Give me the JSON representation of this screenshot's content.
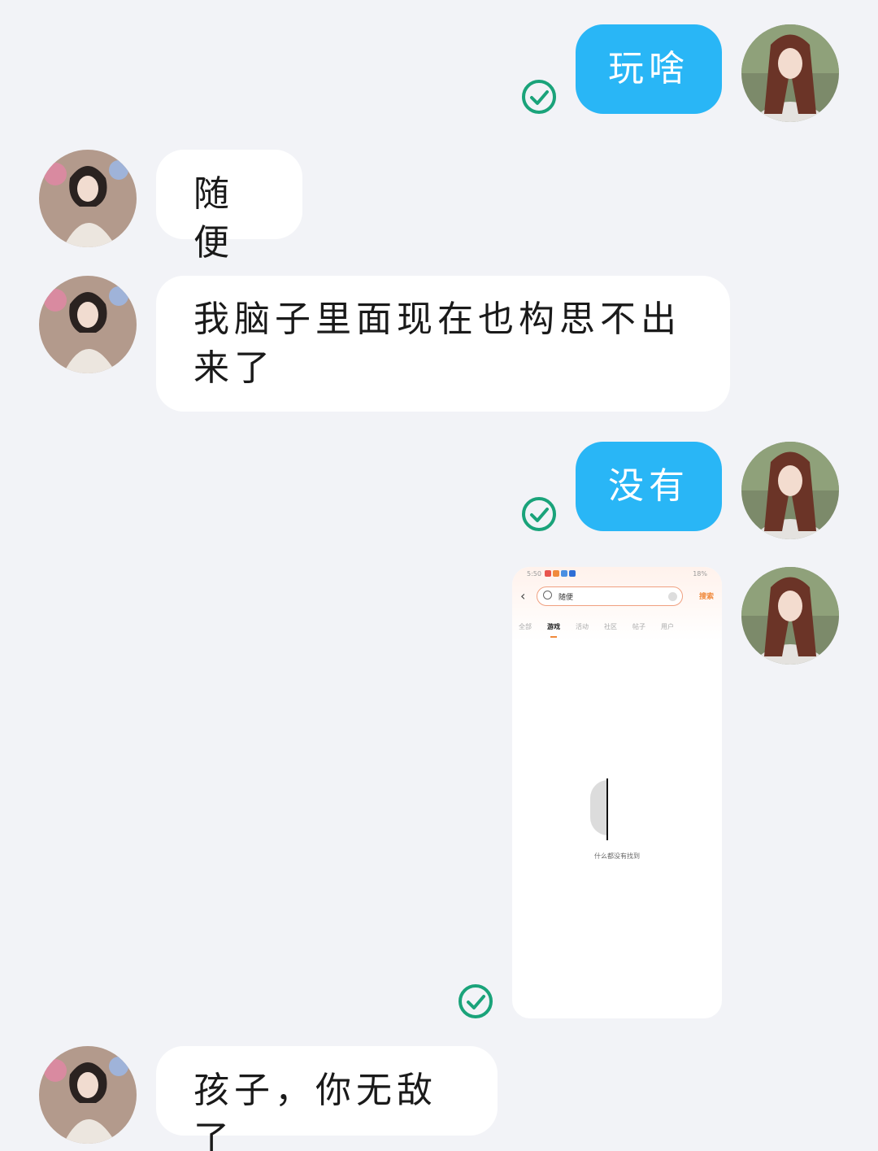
{
  "messages": [
    {
      "from": "me",
      "text": "玩啥",
      "status": "read"
    },
    {
      "from": "them",
      "text": "随便"
    },
    {
      "from": "them",
      "text": "我脑子里面现在也构思不出来了"
    },
    {
      "from": "me",
      "text": "没有",
      "status": "read"
    },
    {
      "from": "me",
      "type": "image",
      "status": "read"
    },
    {
      "from": "them",
      "text": "孩子，你无敌了"
    }
  ],
  "embedded_screenshot": {
    "status_time": "5:50",
    "status_right": "18%",
    "search_query": "随便",
    "search_button": "搜索",
    "tabs": [
      "全部",
      "游戏",
      "活动",
      "社区",
      "帖子",
      "用户"
    ],
    "active_tab": "游戏",
    "empty_text": "什么都没有找到"
  },
  "colors": {
    "background": "#f2f3f7",
    "my_bubble": "#29b6f6",
    "their_bubble": "#ffffff",
    "read_check": "#1aa37a"
  }
}
